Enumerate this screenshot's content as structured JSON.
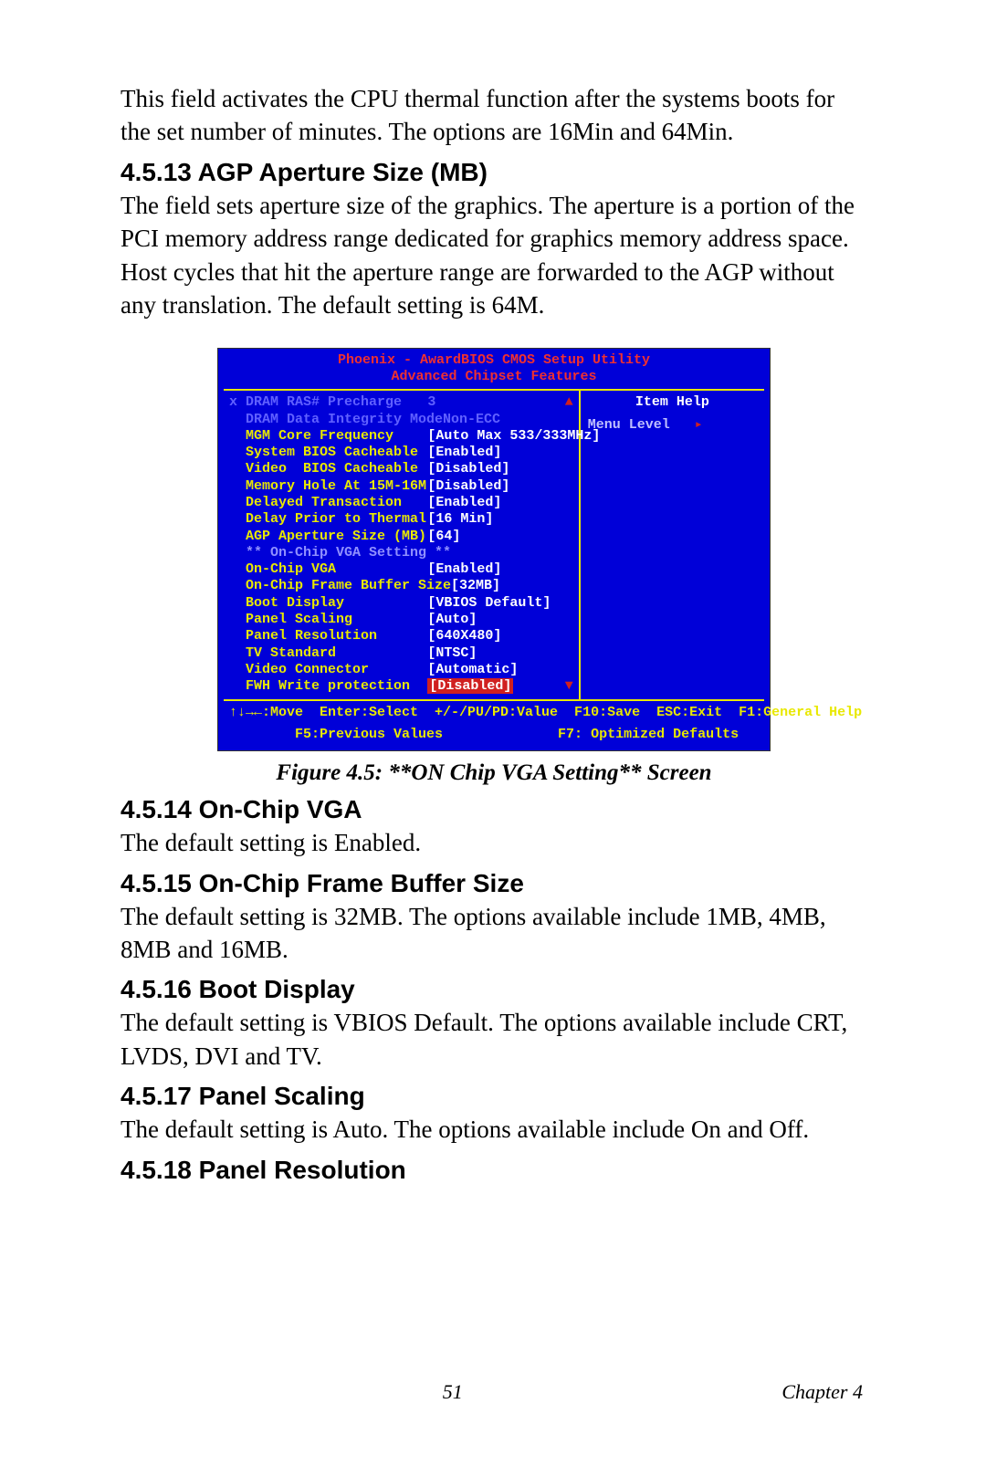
{
  "intro": {
    "p1": "This field activates the CPU thermal function after the systems boots for the set number of minutes. The options are 16Min and 64Min."
  },
  "sections": {
    "s1_title": "4.5.13 AGP Aperture Size (MB)",
    "s1_body": "The field sets aperture size of the graphics. The aperture is a portion of the PCI memory address range dedicated for graphics memory address space. Host cycles that hit the aperture range are forwarded to the AGP without any translation. The default setting is 64M.",
    "s2_title": "4.5.14 On-Chip VGA",
    "s2_body": "The default setting is Enabled.",
    "s3_title": "4.5.15 On-Chip Frame Buffer Size",
    "s3_body": "The default setting is 32MB. The options available include 1MB, 4MB, 8MB and 16MB.",
    "s4_title": "4.5.16 Boot Display",
    "s4_body": "The default setting is VBIOS Default. The options available include CRT, LVDS, DVI and TV.",
    "s5_title": "4.5.17 Panel Scaling",
    "s5_body": "The default setting is Auto. The options available include On and Off.",
    "s6_title": "4.5.18 Panel Resolution"
  },
  "figure_caption": "Figure 4.5: **ON Chip VGA Setting** Screen",
  "bios": {
    "title": "Phoenix - AwardBIOS CMOS Setup Utility",
    "subtitle": "Advanced Chipset Features",
    "help_title": "Item Help",
    "menu_level": "Menu Level",
    "menu_arrow": "▸",
    "scroll_up": "▲",
    "scroll_down": "▼",
    "rows": [
      {
        "label": "x DRAM RAS# Precharge",
        "value": "3",
        "dim": true
      },
      {
        "label": "  DRAM Data Integrity Mode",
        "value": "Non-ECC",
        "dim": true
      },
      {
        "label": "  MGM Core Frequency",
        "value": "[Auto Max 533/333MHz]"
      },
      {
        "label": "  System BIOS Cacheable",
        "value": "[Enabled]"
      },
      {
        "label": "  Video  BIOS Cacheable",
        "value": "[Disabled]"
      },
      {
        "label": "  Memory Hole At 15M-16M",
        "value": "[Disabled]"
      },
      {
        "label": "  Delayed Transaction",
        "value": "[Enabled]"
      },
      {
        "label": "  Delay Prior to Thermal",
        "value": "[16 Min]"
      },
      {
        "label": "  AGP Aperture Size (MB)",
        "value": "[64]"
      },
      {
        "label": "",
        "value": ""
      },
      {
        "label": "  ** On-Chip VGA Setting **",
        "value": "",
        "sep": true
      },
      {
        "label": "  On-Chip VGA",
        "value": "[Enabled]"
      },
      {
        "label": "  On-Chip Frame Buffer Size",
        "value": "[32MB]"
      },
      {
        "label": "  Boot Display",
        "value": "[VBIOS Default]"
      },
      {
        "label": "  Panel Scaling",
        "value": "[Auto]"
      },
      {
        "label": "  Panel Resolution",
        "value": "[640X480]"
      },
      {
        "label": "  TV Standard",
        "value": "[NTSC]"
      },
      {
        "label": "  Video Connector",
        "value": "[Automatic]"
      },
      {
        "label": "  FWH Write protection",
        "value": "",
        "hl_value": "[Disabled]"
      }
    ],
    "foot1": "↑↓→←:Move  Enter:Select  +/-/PU/PD:Value  F10:Save  ESC:Exit  F1:General Help",
    "foot2": "        F5:Previous Values              F7: Optimized Defaults"
  },
  "footer": {
    "page": "51",
    "chapter": "Chapter 4"
  }
}
